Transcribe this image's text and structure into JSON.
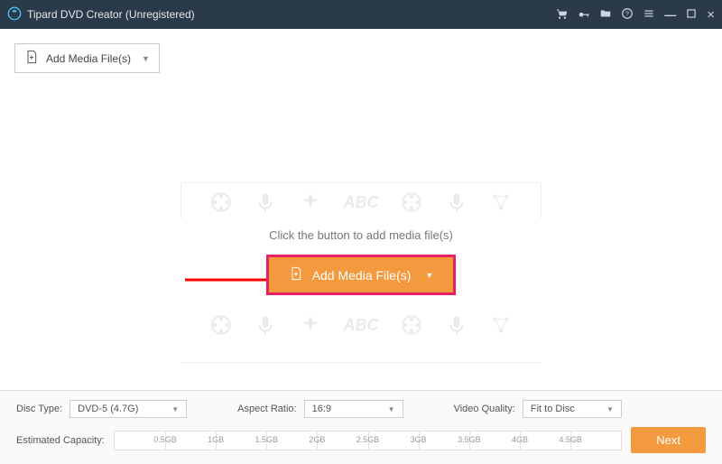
{
  "titlebar": {
    "title": "Tipard DVD Creator (Unregistered)"
  },
  "toolbar": {
    "add_media_label": "Add Media File(s)"
  },
  "main": {
    "hint": "Click the button to add media file(s)",
    "add_media_label": "Add Media File(s)",
    "watermark_text": "ABC"
  },
  "footer": {
    "disc_type_label": "Disc Type:",
    "disc_type_value": "DVD-5 (4.7G)",
    "aspect_ratio_label": "Aspect Ratio:",
    "aspect_ratio_value": "16:9",
    "video_quality_label": "Video Quality:",
    "video_quality_value": "Fit to Disc",
    "estimated_capacity_label": "Estimated Capacity:",
    "ticks": [
      "0.5GB",
      "1GB",
      "1.5GB",
      "2GB",
      "2.5GB",
      "3GB",
      "3.5GB",
      "4GB",
      "4.5GB"
    ],
    "next_label": "Next"
  }
}
